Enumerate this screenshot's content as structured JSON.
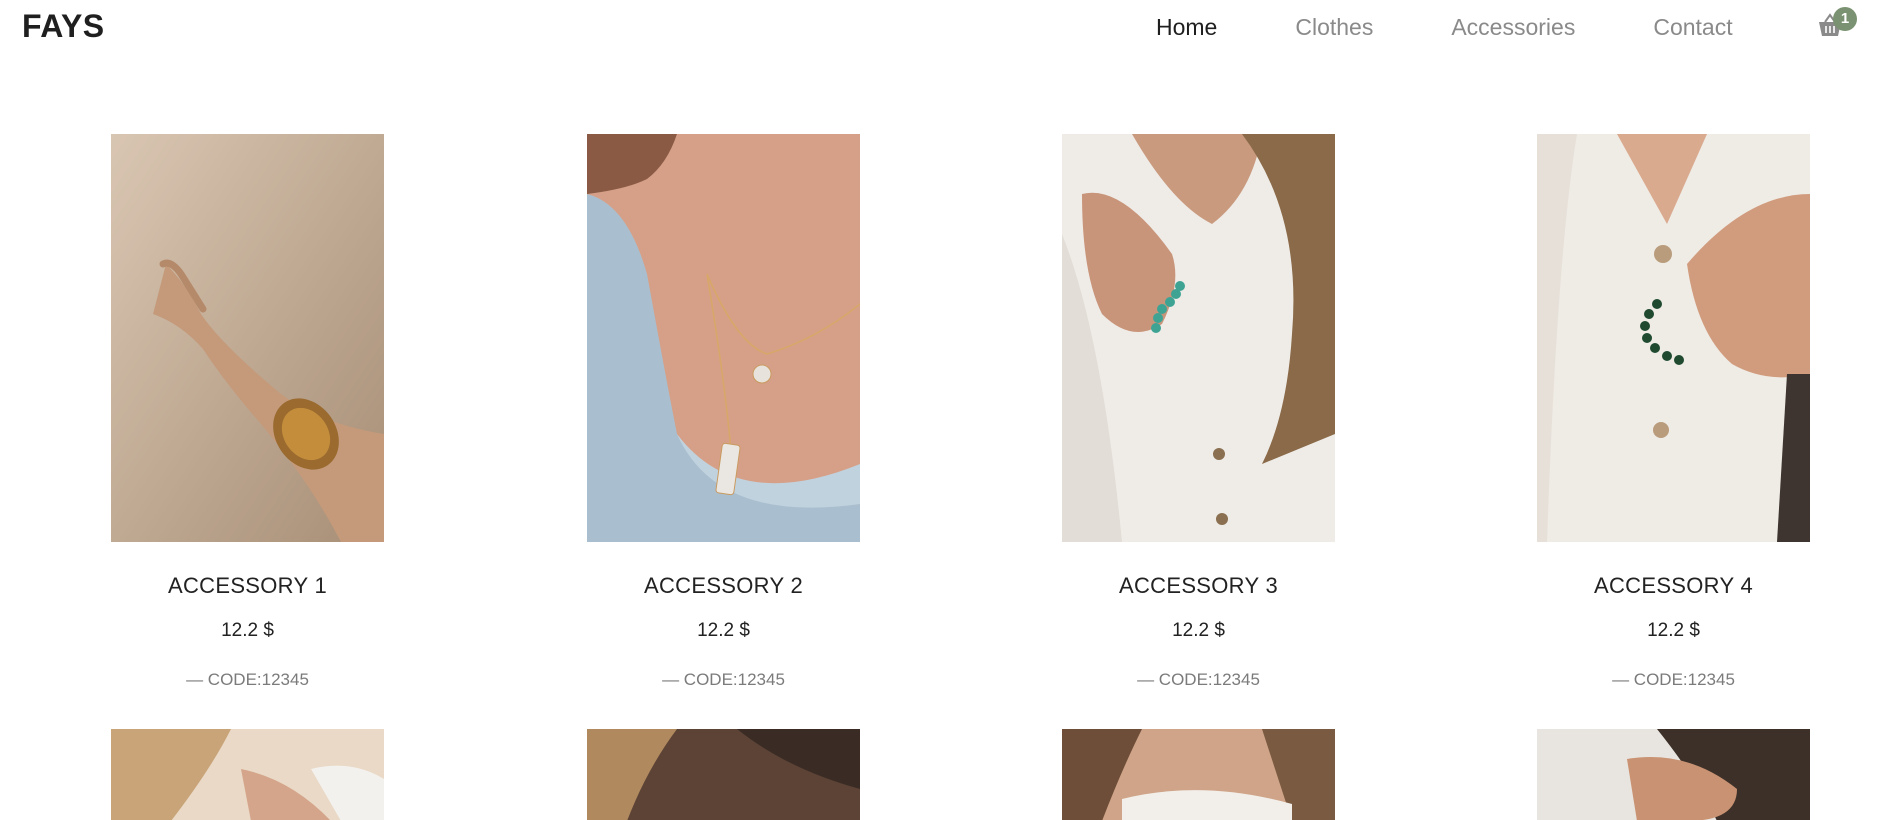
{
  "brand": "FAYS",
  "nav": {
    "items": [
      {
        "label": "Home",
        "active": true
      },
      {
        "label": "Clothes",
        "active": false
      },
      {
        "label": "Accessories",
        "active": false
      },
      {
        "label": "Contact",
        "active": false
      }
    ],
    "cart_icon": "basket-icon",
    "cart_count": "1"
  },
  "colors": {
    "accent": "#7a9271",
    "text": "#222222",
    "muted": "#8a8a8a"
  },
  "products": [
    {
      "name": "ACCESSORY 1",
      "price": "12.2 $",
      "code": "— CODE:12345"
    },
    {
      "name": "ACCESSORY 2",
      "price": "12.2 $",
      "code": "— CODE:12345"
    },
    {
      "name": "ACCESSORY 3",
      "price": "12.2 $",
      "code": "— CODE:12345"
    },
    {
      "name": "ACCESSORY 4",
      "price": "12.2 $",
      "code": "— CODE:12345"
    }
  ]
}
